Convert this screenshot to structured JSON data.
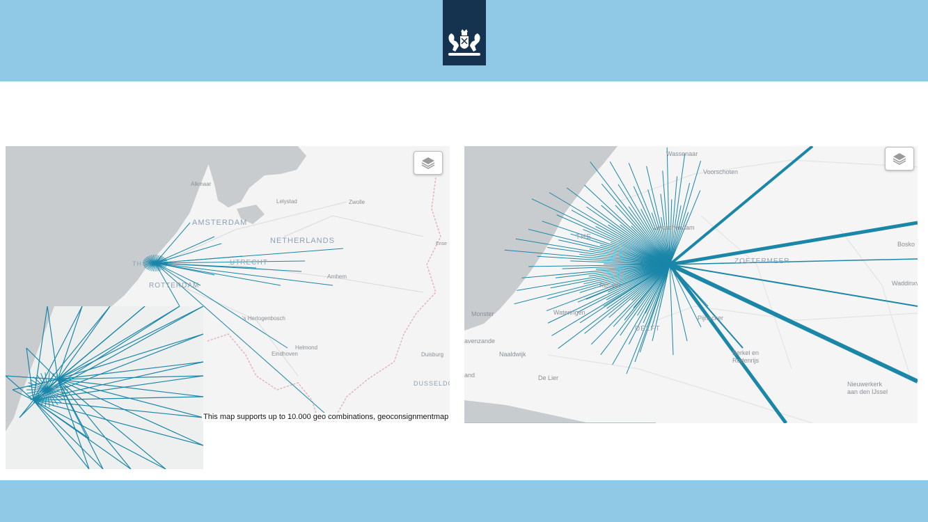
{
  "header": {
    "logo_icon": "royal-coat-of-arms-icon"
  },
  "colors": {
    "band": "#8fc9e6",
    "logo_bg": "#15324f",
    "flow": "#1a86a8",
    "water": "#c9ccce",
    "land": "#f3f4f3"
  },
  "map_left": {
    "layers_icon": "layers-icon",
    "labels": {
      "alkmaar": "Alkmaar",
      "lelystad": "Lelystad",
      "zwolle": "Zwolle",
      "amsterdam": "AMSTERDAM",
      "netherlands": "NETHERLANDS",
      "utrecht": "UTRECHT",
      "arnhem": "Arnhem",
      "rotterdam": "ROTTERDAM",
      "thehague": "TH",
      "den_bosch": "'s Hertogenbosch",
      "helmond": "Helmond",
      "eindhoven": "Eindhoven",
      "duisburg": "Duisburg",
      "dusseldorf": "DUSSELDO",
      "ense": "Ense"
    },
    "caption": "This map supports up to 10.000 geo combinations, geoconsignmentmap"
  },
  "map_right": {
    "layers_icon": "layers-icon",
    "labels": {
      "wassenaar": "Wassenaar",
      "voorschoten": "Voorschoten",
      "leidschendam": "Leidschendam",
      "zoetermeer": "ZOETERMEER",
      "rijswijk": "Rijswijk",
      "monster": "Monster",
      "wateringen": "Wateringen",
      "delft": "DELFT",
      "pijnacker": "Pijnacker",
      "berkel": "Berkel en",
      "rodenrijs": "Rodenrijs",
      "gravenzande": "avenzande",
      "naaldwijk": "Naaldwijk",
      "delier": "De Lier",
      "waddinxveen": "Waddinxv",
      "boskoop": "Bosko",
      "nieuwerkerk": "Nieuwerkerk",
      "aandenijssel": "aan den IJssel",
      "land": "and",
      "the": "THE"
    }
  }
}
